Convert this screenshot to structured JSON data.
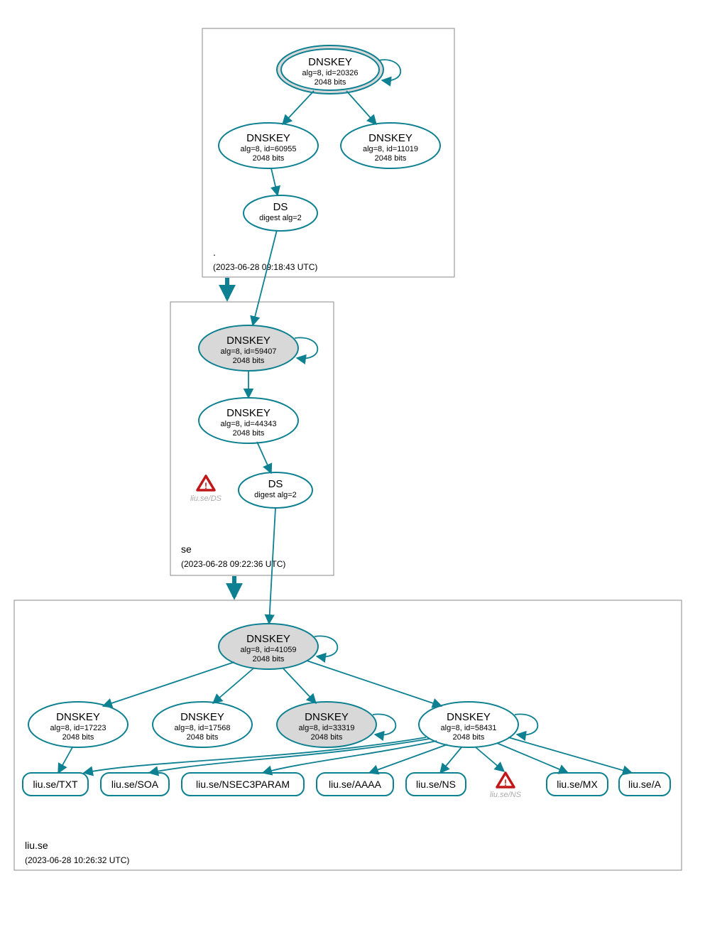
{
  "zones": {
    "root": {
      "label": ".",
      "time": "(2023-06-28 09:18:43 UTC)",
      "nodes": {
        "ksk": {
          "title": "DNSKEY",
          "sub1": "alg=8, id=20326",
          "sub2": "2048 bits"
        },
        "zsk1": {
          "title": "DNSKEY",
          "sub1": "alg=8, id=60955",
          "sub2": "2048 bits"
        },
        "zsk2": {
          "title": "DNSKEY",
          "sub1": "alg=8, id=11019",
          "sub2": "2048 bits"
        },
        "ds": {
          "title": "DS",
          "sub1": "digest alg=2"
        }
      }
    },
    "se": {
      "label": "se",
      "time": "(2023-06-28 09:22:36 UTC)",
      "nodes": {
        "ksk": {
          "title": "DNSKEY",
          "sub1": "alg=8, id=59407",
          "sub2": "2048 bits"
        },
        "zsk": {
          "title": "DNSKEY",
          "sub1": "alg=8, id=44343",
          "sub2": "2048 bits"
        },
        "ds": {
          "title": "DS",
          "sub1": "digest alg=2"
        }
      },
      "warn": {
        "label": "liu.se/DS"
      }
    },
    "liu": {
      "label": "liu.se",
      "time": "(2023-06-28 10:26:32 UTC)",
      "nodes": {
        "ksk": {
          "title": "DNSKEY",
          "sub1": "alg=8, id=41059",
          "sub2": "2048 bits"
        },
        "k1": {
          "title": "DNSKEY",
          "sub1": "alg=8, id=17223",
          "sub2": "2048 bits"
        },
        "k2": {
          "title": "DNSKEY",
          "sub1": "alg=8, id=17568",
          "sub2": "2048 bits"
        },
        "k3": {
          "title": "DNSKEY",
          "sub1": "alg=8, id=33319",
          "sub2": "2048 bits"
        },
        "k4": {
          "title": "DNSKEY",
          "sub1": "alg=8, id=58431",
          "sub2": "2048 bits"
        }
      },
      "rr": {
        "txt": "liu.se/TXT",
        "soa": "liu.se/SOA",
        "nsec3": "liu.se/NSEC3PARAM",
        "aaaa": "liu.se/AAAA",
        "ns": "liu.se/NS",
        "mx": "liu.se/MX",
        "a": "liu.se/A"
      },
      "warn": {
        "label": "liu.se/NS"
      }
    }
  }
}
